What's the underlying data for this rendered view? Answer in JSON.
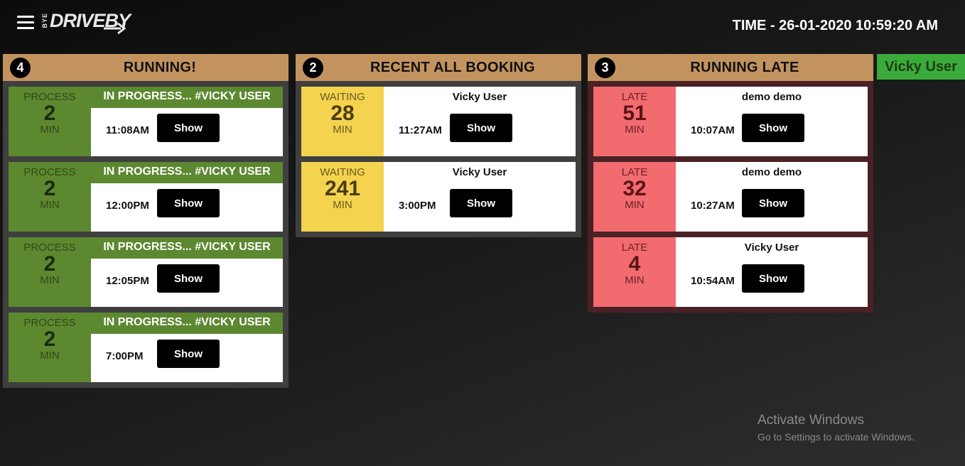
{
  "header": {
    "menu_icon": "hamburger-icon",
    "logo": {
      "small_text": "BYE",
      "main_text": "DRIVEBY",
      "arrow_icon": "arrow-right-icon"
    },
    "clock": "TIME - 26-01-2020 10:59:20 AM"
  },
  "running": {
    "count": "4",
    "title": "RUNNING!",
    "cards": [
      {
        "status": "PROCESS",
        "mins": "2",
        "unit": "MIN",
        "label": "IN PROGRESS... #VICKY USER",
        "time": "11:08AM",
        "button": "Show"
      },
      {
        "status": "PROCESS",
        "mins": "2",
        "unit": "MIN",
        "label": "IN PROGRESS... #VICKY USER",
        "time": "12:00PM",
        "button": "Show"
      },
      {
        "status": "PROCESS",
        "mins": "2",
        "unit": "MIN",
        "label": "IN PROGRESS... #VICKY USER",
        "time": "12:05PM",
        "button": "Show"
      },
      {
        "status": "PROCESS",
        "mins": "2",
        "unit": "MIN",
        "label": "IN PROGRESS... #VICKY USER",
        "time": "7:00PM",
        "button": "Show"
      }
    ]
  },
  "booking": {
    "count": "2",
    "title": "RECENT ALL BOOKING",
    "cards": [
      {
        "status": "WAITING",
        "mins": "28",
        "unit": "MIN",
        "name": "Vicky User",
        "time": "11:27AM",
        "button": "Show"
      },
      {
        "status": "WAITING",
        "mins": "241",
        "unit": "MIN",
        "name": "Vicky User",
        "time": "3:00PM",
        "button": "Show"
      }
    ]
  },
  "late": {
    "count": "3",
    "title": "RUNNING LATE",
    "cards": [
      {
        "status": "LATE",
        "mins": "51",
        "unit": "MIN",
        "name": "demo demo",
        "time": "10:07AM",
        "button": "Show"
      },
      {
        "status": "LATE",
        "mins": "32",
        "unit": "MIN",
        "name": "demo demo",
        "time": "10:27AM",
        "button": "Show"
      },
      {
        "status": "LATE",
        "mins": "4",
        "unit": "MIN",
        "name": "Vicky User",
        "time": "10:54AM",
        "button": "Show"
      }
    ]
  },
  "user_badge": "Vicky User",
  "watermark": {
    "title": "Activate Windows",
    "subtitle": "Go to Settings to activate Windows."
  },
  "colors": {
    "running_accent": "#5c8830",
    "waiting_accent": "#f4d34f",
    "late_accent": "#f26b6f",
    "header_bar": "#c3935f",
    "user_badge": "#3aab3b"
  }
}
